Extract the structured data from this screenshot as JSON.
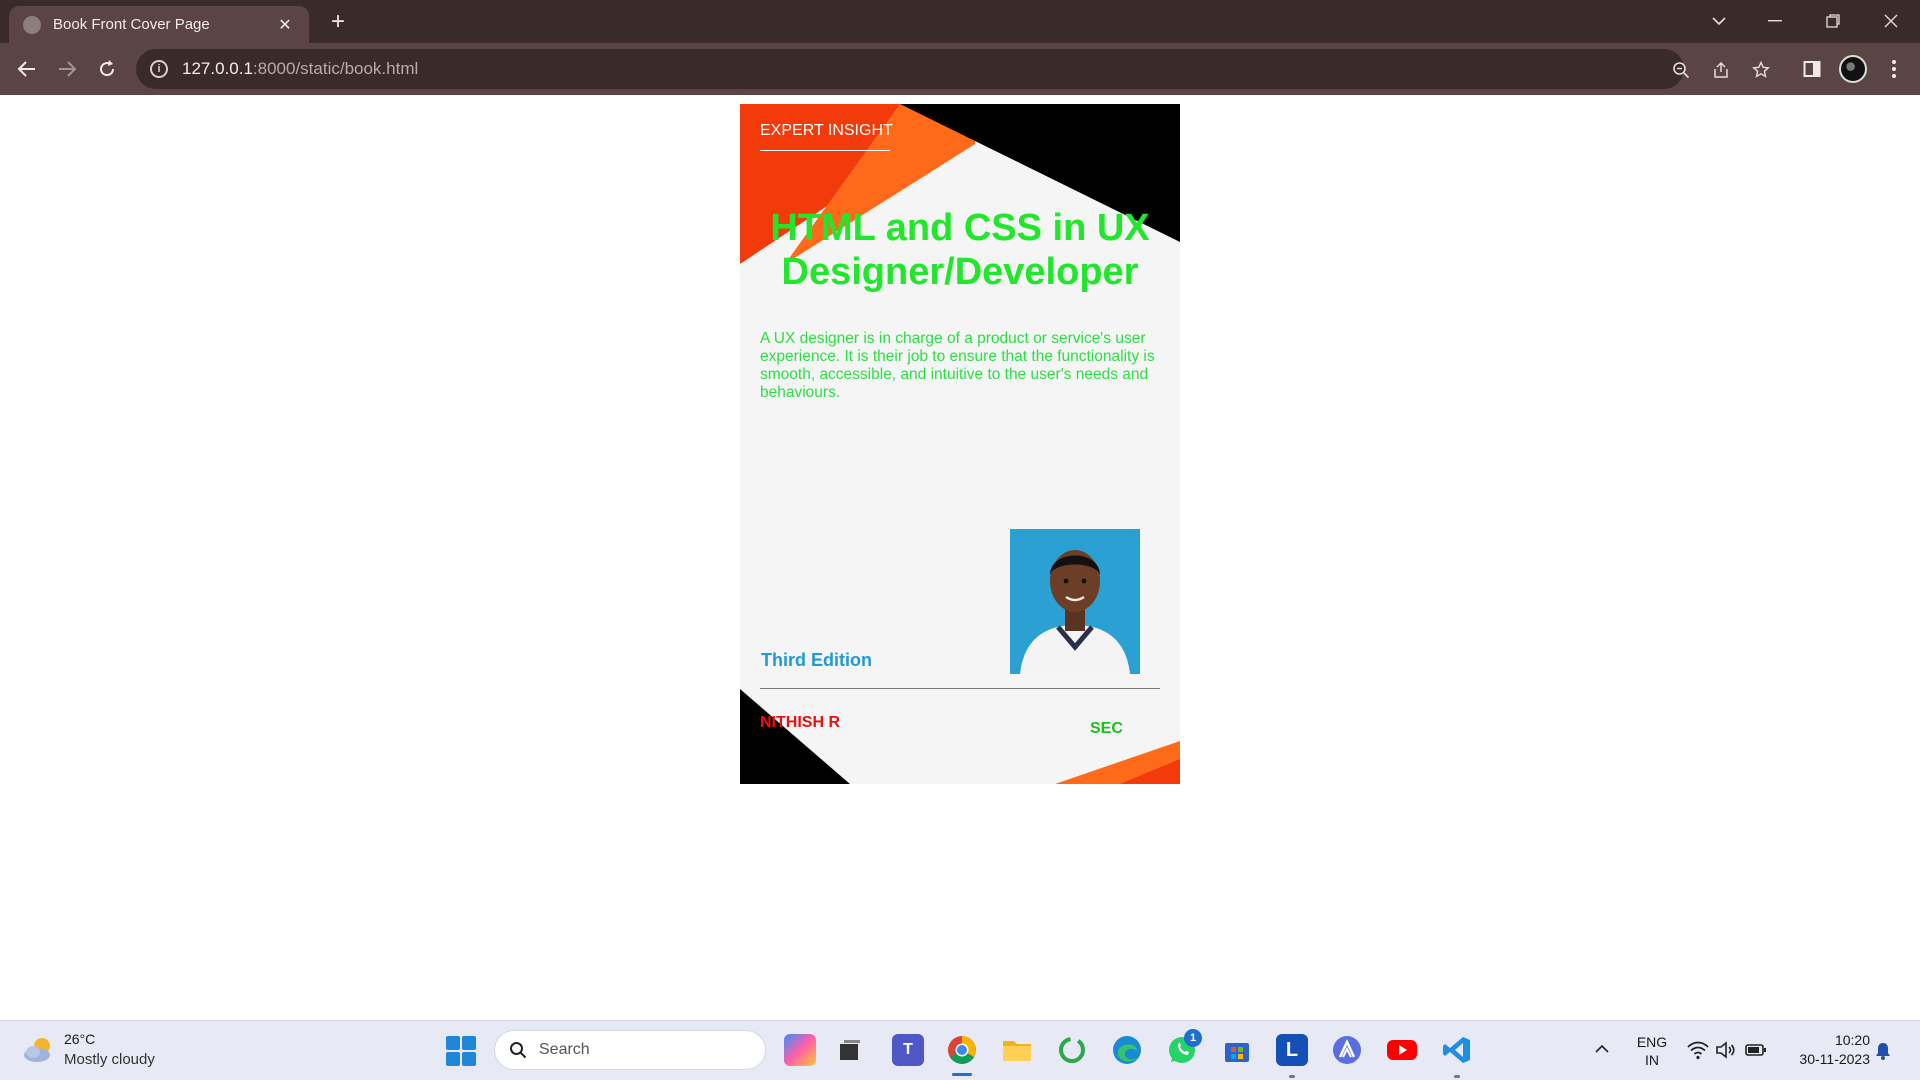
{
  "browser": {
    "tab_title": "Book Front Cover Page",
    "url_host": "127.0.0.1",
    "url_rest": ":8000/static/book.html"
  },
  "cover": {
    "series_label": "EXPERT INSIGHT",
    "title": "HTML and CSS in UX Designer/Developer",
    "description": "A UX designer is in charge of a product or service's user experience. It is their job to ensure that the functionality is smooth, accessible, and intuitive to the user's needs and behaviours.",
    "edition": "Third Edition",
    "author": "NITHISH R",
    "publisher": "SEC",
    "colors": {
      "title": "#22e62b",
      "description": "#2adf44",
      "edition": "#1e9ad6",
      "author": "#e81010",
      "publisher": "#19c21f",
      "accent_orange": "#ff6a1a",
      "accent_red": "#f23a0a",
      "black": "#000000"
    }
  },
  "taskbar": {
    "weather_temp": "26°C",
    "weather_desc": "Mostly cloudy",
    "search_placeholder": "Search",
    "whatsapp_badge": "1",
    "lang_line1": "ENG",
    "lang_line2": "IN",
    "time": "10:20",
    "date": "30-11-2023"
  }
}
